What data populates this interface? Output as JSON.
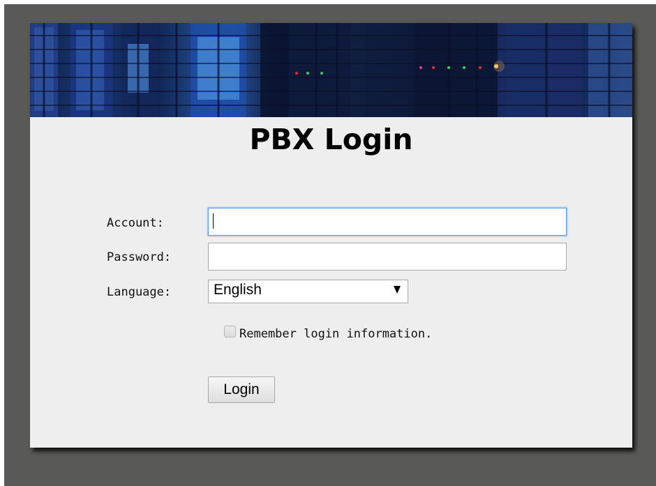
{
  "login": {
    "title": "PBX Login",
    "account_label": "Account:",
    "account_value": "",
    "password_label": "Password:",
    "password_value": "",
    "language_label": "Language:",
    "language_selected": "English",
    "remember_label": "Remember login information.",
    "remember_checked": false,
    "login_button": "Login"
  },
  "colors": {
    "backdrop": "#595957",
    "panel": "#eeeeee",
    "input_focus_border": "#5b9ee6"
  },
  "icons": {
    "dropdown": "chevron-down-icon",
    "banner": "server-rack-image"
  }
}
